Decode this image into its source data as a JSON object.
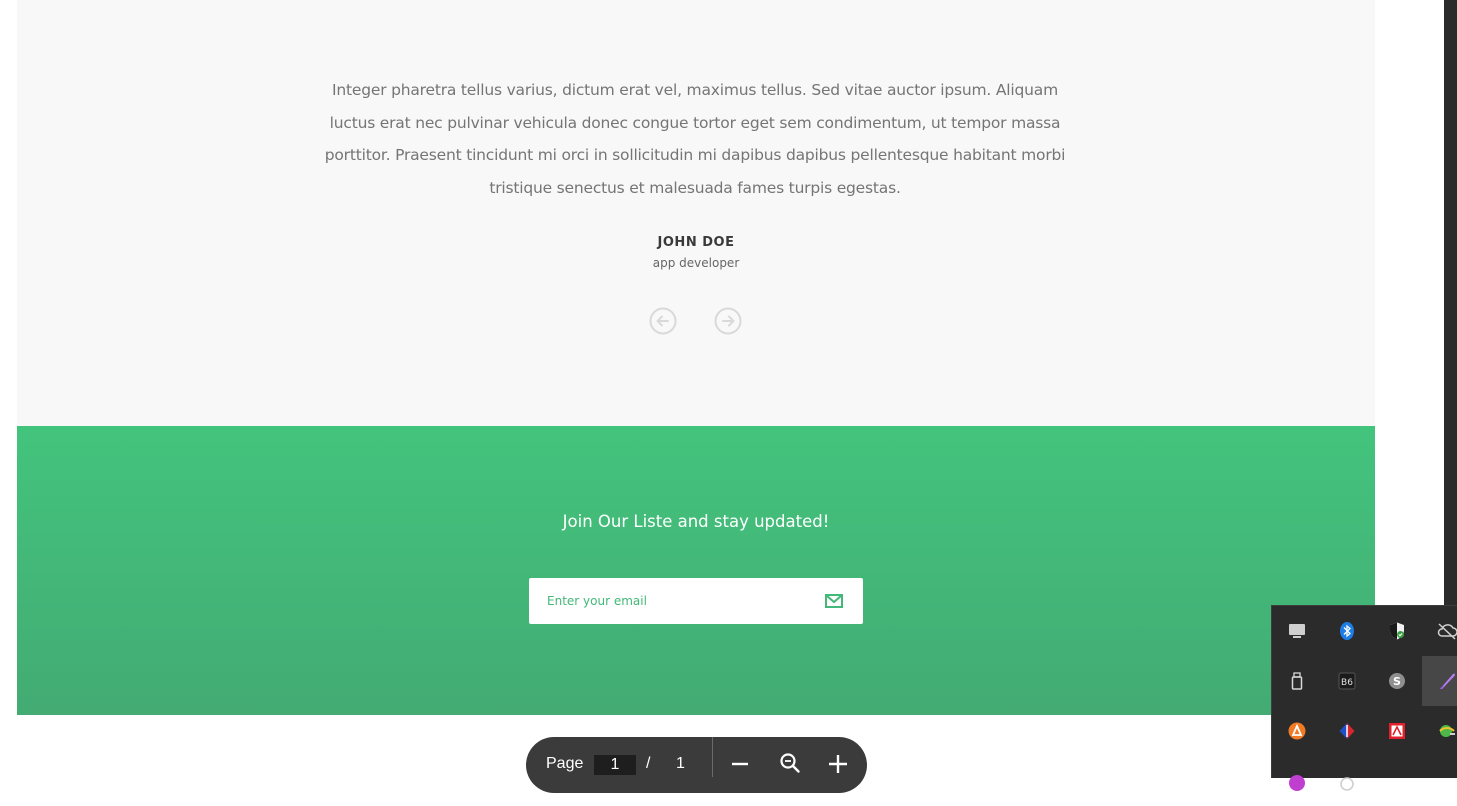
{
  "testimonial": {
    "quote": "Integer pharetra tellus varius, dictum erat vel, maximus tellus. Sed vitae auctor ipsum. Aliquam luctus erat nec pulvinar vehicula donec congue tortor eget sem condimentum, ut tempor massa porttitor. Praesent tincidunt mi orci  in sollicitudin mi dapibus dapibus pellentesque habitant morbi tristique senectus et malesuada fames turpis egestas.",
    "author_name": "JOHN DOE",
    "author_role": "app developer",
    "prev_icon": "arrow-left-circle-icon",
    "next_icon": "arrow-right-circle-icon"
  },
  "newsletter": {
    "title": "Join Our Liste and stay updated!",
    "email_placeholder": "Enter your email",
    "submit_icon": "envelope-icon",
    "accent_color": "#43c47d"
  },
  "pdf_toolbar": {
    "page_label": "Page",
    "current_page": "1",
    "separator": "/",
    "total_pages": "1",
    "buttons": [
      "zoom-out-icon",
      "search-zoom-icon",
      "zoom-in-icon"
    ]
  },
  "system_tray": {
    "icons": [
      "display-icon",
      "bluetooth-icon",
      "security-shield-icon",
      "cloud-icon",
      "usb-drive-icon",
      "video-app-icon",
      "skype-icon",
      "pen-icon",
      "avast-icon",
      "language-flag-icon",
      "adobe-acrobat-icon",
      "network-globe-icon",
      "paint-app-icon",
      "cursor-app-icon"
    ]
  }
}
